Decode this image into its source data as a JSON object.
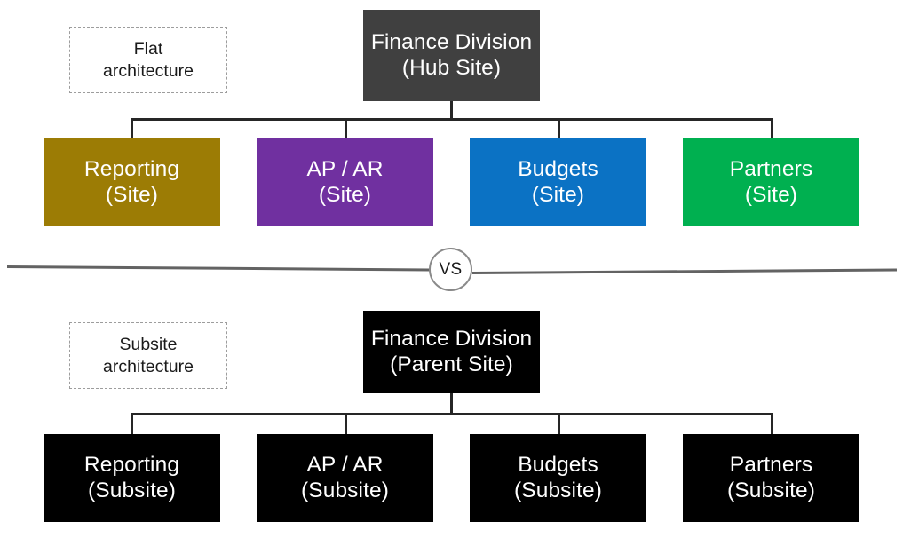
{
  "diagram": {
    "title": "Flat architecture vs Subsite architecture",
    "comparison_label": "VS",
    "colors": {
      "hub_gray": "#404040",
      "black": "#000000",
      "gold": "#9C7C05",
      "purple": "#7030A0",
      "blue": "#0B72C4",
      "green": "#00B050",
      "connector": "#262626",
      "divider": "#636363",
      "dashed_border": "#9D9D9D",
      "text_on_fill": "#FFFFFF",
      "text_dark": "#1A1A1A"
    }
  },
  "flat": {
    "caption": {
      "line1": "Flat",
      "line2": "architecture"
    },
    "root": {
      "line1": "Finance Division",
      "line2": "(Hub Site)",
      "color": "#404040"
    },
    "children": [
      {
        "line1": "Reporting",
        "line2": "(Site)",
        "color": "#9C7C05"
      },
      {
        "line1": "AP / AR",
        "line2": "(Site)",
        "color": "#7030A0"
      },
      {
        "line1": "Budgets",
        "line2": "(Site)",
        "color": "#0B72C4"
      },
      {
        "line1": "Partners",
        "line2": "(Site)",
        "color": "#00B050"
      }
    ]
  },
  "subsite": {
    "caption": {
      "line1": "Subsite",
      "line2": "architecture"
    },
    "root": {
      "line1": "Finance Division",
      "line2": "(Parent Site)",
      "color": "#000000"
    },
    "children": [
      {
        "line1": "Reporting",
        "line2": "(Subsite)",
        "color": "#000000"
      },
      {
        "line1": "AP / AR",
        "line2": "(Subsite)",
        "color": "#000000"
      },
      {
        "line1": "Budgets",
        "line2": "(Subsite)",
        "color": "#000000"
      },
      {
        "line1": "Partners",
        "line2": "(Subsite)",
        "color": "#000000"
      }
    ]
  }
}
